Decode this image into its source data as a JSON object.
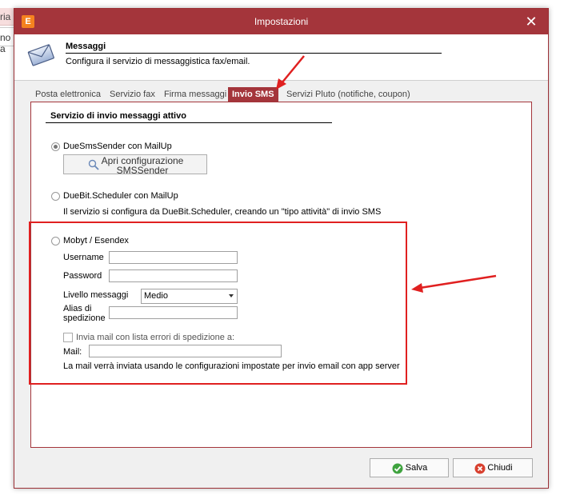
{
  "background": {
    "fragment_top": "ria",
    "fragment_mid": "no a"
  },
  "window": {
    "app_icon_letter": "E",
    "title": "Impostazioni",
    "close_glyph": "✕"
  },
  "header": {
    "title": "Messaggi",
    "subtitle": "Configura il servizio di messaggistica fax/email."
  },
  "tabs": [
    {
      "label": "Posta elettronica",
      "active": false
    },
    {
      "label": "Servizio fax",
      "active": false
    },
    {
      "label": "Firma messaggi",
      "active": false
    },
    {
      "label": "Invio SMS",
      "active": true
    },
    {
      "label": "Servizi Pluto (notifiche, coupon)",
      "active": false
    }
  ],
  "panel": {
    "section_title": "Servizio di invio messaggi attivo",
    "option1": {
      "label": "DueSmsSender con MailUp",
      "selected": true,
      "button_line1": "Apri configurazione",
      "button_line2": "SMSSender"
    },
    "option2": {
      "label": "DueBit.Scheduler con MailUp",
      "selected": false,
      "description": "Il servizio si configura da DueBit.Scheduler, creando un \"tipo attività\" di invio SMS"
    },
    "option3": {
      "label": "Mobyt / Esendex",
      "selected": false,
      "username_label": "Username",
      "username_value": "",
      "password_label": "Password",
      "password_value": "",
      "level_label": "Livello messaggi",
      "level_value": "Medio",
      "alias_label_line1": "Alias di",
      "alias_label_line2": "spedizione",
      "alias_value": "",
      "send_errors_label": "Invia mail con lista errori di spedizione a:",
      "send_errors_checked": false,
      "mail_label": "Mail:",
      "mail_value": "",
      "note": "La mail verrà inviata usando le configurazioni impostate per invio email con app server"
    }
  },
  "footer": {
    "save_label": "Salva",
    "close_label": "Chiudi"
  },
  "colors": {
    "titlebar": "#a4353b",
    "accent_orange": "#f5821f",
    "annotation_red": "#e02020"
  }
}
